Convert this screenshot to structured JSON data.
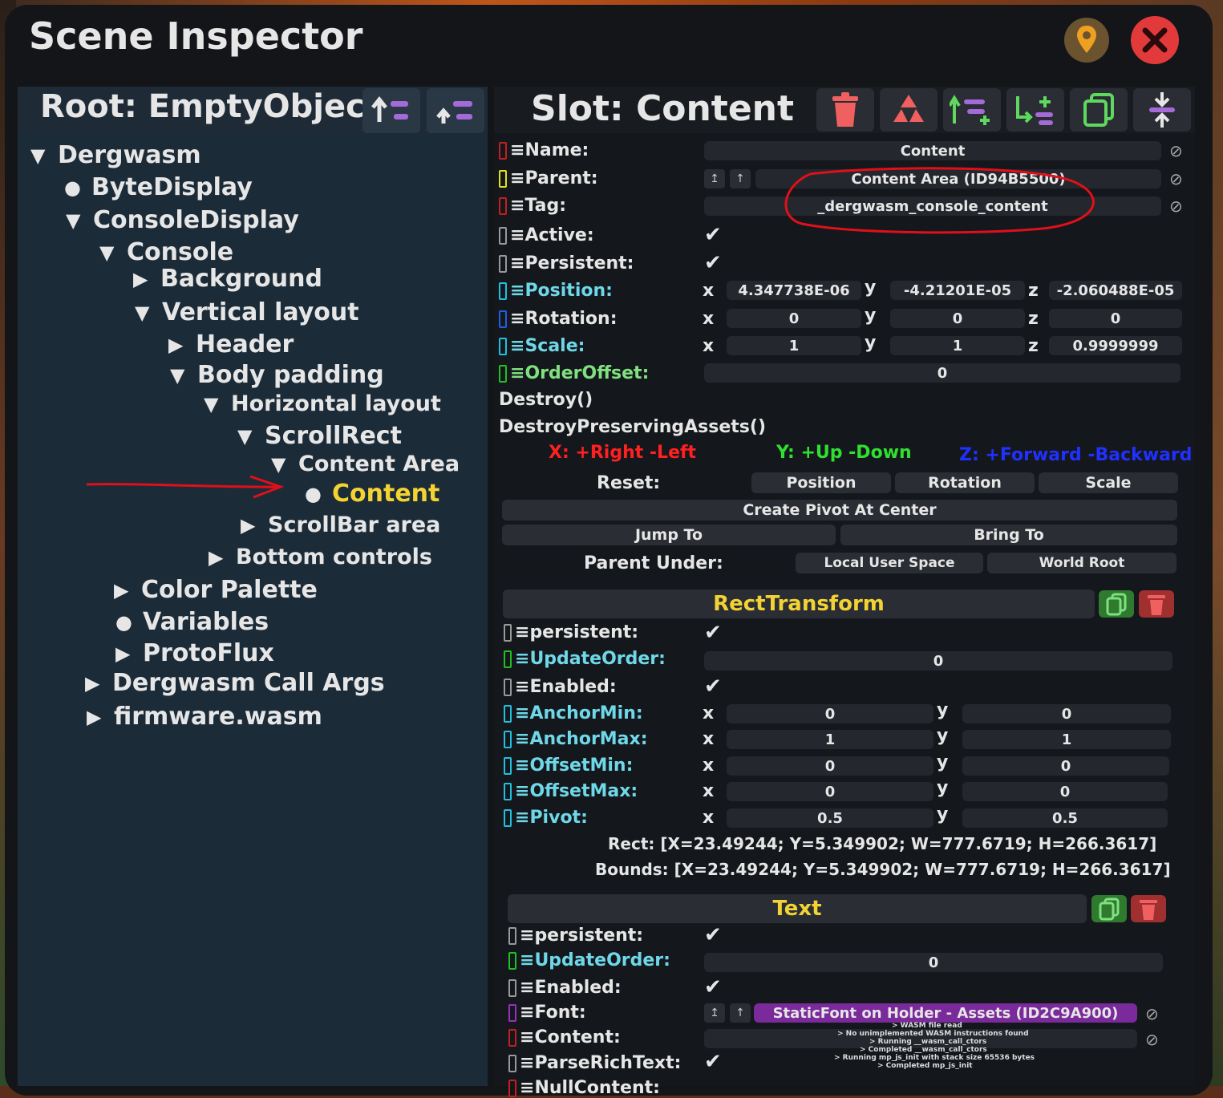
{
  "window": {
    "title": "Scene Inspector"
  },
  "hierarchy": {
    "root_title": "Root: EmptyObject",
    "items": [
      {
        "label": "Dergwasm",
        "state": "expanded"
      },
      {
        "label": "ByteDisplay",
        "state": "leaf"
      },
      {
        "label": "ConsoleDisplay",
        "state": "expanded"
      },
      {
        "label": "Console",
        "state": "expanded"
      },
      {
        "label": "Background",
        "state": "collapsed"
      },
      {
        "label": "Vertical layout",
        "state": "expanded"
      },
      {
        "label": "Header",
        "state": "collapsed"
      },
      {
        "label": "Body padding",
        "state": "expanded"
      },
      {
        "label": "Horizontal layout",
        "state": "expanded"
      },
      {
        "label": "ScrollRect",
        "state": "expanded"
      },
      {
        "label": "Content Area",
        "state": "expanded"
      },
      {
        "label": "Content",
        "state": "leaf",
        "selected": true
      },
      {
        "label": "ScrollBar area",
        "state": "collapsed"
      },
      {
        "label": "Bottom controls",
        "state": "collapsed"
      },
      {
        "label": "Color Palette",
        "state": "collapsed"
      },
      {
        "label": "Variables",
        "state": "leaf"
      },
      {
        "label": "ProtoFlux",
        "state": "collapsed"
      },
      {
        "label": "Dergwasm Call Args",
        "state": "collapsed"
      },
      {
        "label": "firmware.wasm",
        "state": "collapsed"
      }
    ]
  },
  "slot": {
    "title": "Slot: Content",
    "name_label": "Name:",
    "name_value": "Content",
    "parent_label": "Parent:",
    "parent_value": "Content Area (ID94B5500)",
    "tag_label": "Tag:",
    "tag_value": "_dergwasm_console_content",
    "active_label": "Active:",
    "persistent_label": "Persistent:",
    "position_label": "Position:",
    "position": {
      "x": "4.347738E-06",
      "y": "-4.21201E-05",
      "z": "-2.060488E-05"
    },
    "rotation_label": "Rotation:",
    "rotation": {
      "x": "0",
      "y": "0",
      "z": "0"
    },
    "scale_label": "Scale:",
    "scale": {
      "x": "1",
      "y": "1",
      "z": "0.9999999"
    },
    "orderoffset_label": "OrderOffset:",
    "orderoffset_value": "0",
    "destroy": "Destroy()",
    "destroy_preserving": "DestroyPreservingAssets()",
    "axis_hint_x": "X: +Right -Left",
    "axis_hint_y": "Y: +Up -Down",
    "axis_hint_z": "Z: +Forward -Backward",
    "reset_label": "Reset:",
    "reset_position": "Position",
    "reset_rotation": "Rotation",
    "reset_scale": "Scale",
    "create_pivot": "Create Pivot At Center",
    "jump_to": "Jump To",
    "bring_to": "Bring To",
    "parent_under_label": "Parent Under:",
    "local_user_space": "Local User Space",
    "world_root": "World Root"
  },
  "axes": {
    "x": "x",
    "y": "y",
    "z": "z"
  },
  "rect_transform": {
    "title": "RectTransform",
    "persistent_label": "persistent:",
    "updateorder_label": "UpdateOrder:",
    "updateorder_value": "0",
    "enabled_label": "Enabled:",
    "anchormin_label": "AnchorMin:",
    "anchormin": {
      "x": "0",
      "y": "0"
    },
    "anchormax_label": "AnchorMax:",
    "anchormax": {
      "x": "1",
      "y": "1"
    },
    "offsetmin_label": "OffsetMin:",
    "offsetmin": {
      "x": "0",
      "y": "0"
    },
    "offsetmax_label": "OffsetMax:",
    "offsetmax": {
      "x": "0",
      "y": "0"
    },
    "pivot_label": "Pivot:",
    "pivot": {
      "x": "0.5",
      "y": "0.5"
    },
    "rect_text": "Rect: [X=23.49244; Y=5.349902; W=777.6719; H=266.3617]",
    "bounds_text": "Bounds: [X=23.49244; Y=5.349902; W=777.6719; H=266.3617]"
  },
  "text_component": {
    "title": "Text",
    "persistent_label": "persistent:",
    "updateorder_label": "UpdateOrder:",
    "updateorder_value": "0",
    "enabled_label": "Enabled:",
    "font_label": "Font:",
    "font_value": "StaticFont on Holder - Assets (ID2C9A900)",
    "content_label": "Content:",
    "content_lines": [
      "> WASM file read",
      "> No unimplemented WASM instructions found",
      "> Running __wasm_call_ctors",
      "> Completed __wasm_call_ctors",
      "> Running mp_js_init with stack size 65536 bytes",
      "> Completed mp_js_init"
    ],
    "parserichtext_label": "ParseRichText:",
    "nullcontent_label": "NullContent:"
  },
  "colors": {
    "accent_yellow": "#f3d234",
    "danger": "#e23a3a",
    "green_btn": "#2f7a2f",
    "purple_field": "#7a2a9a",
    "annotation": "#e0101a"
  }
}
